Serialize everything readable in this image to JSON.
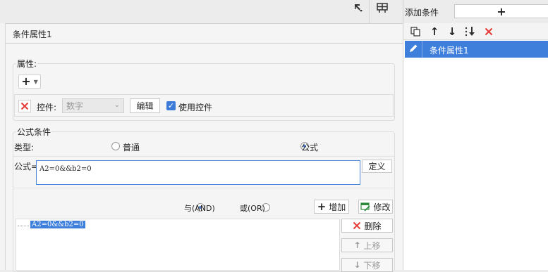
{
  "right_panel": {
    "add_condition_label": "添加条件",
    "add_button_glyph": "+",
    "toolbar_icons": [
      "copy-icon",
      "arrow-up-icon",
      "arrow-down-icon",
      "move-bottom-icon",
      "delete-icon"
    ],
    "items": [
      {
        "label": "条件属性1",
        "selected": true
      }
    ]
  },
  "dialog": {
    "title": "条件属性1",
    "property_group": {
      "label": "属性:",
      "add_glyph": "+",
      "widget_label": "控件:",
      "widget_select_value": "数字",
      "edit_button": "编辑",
      "use_widget_label": "使用控件",
      "use_widget_checked": true
    },
    "formula_group": {
      "label": "公式条件",
      "type_label": "类型:",
      "type_options": [
        "普通",
        "公式"
      ],
      "type_selected": "公式",
      "formula_label": "公式=",
      "formula_value": "A2=0&&b2=0",
      "define_button": "定义",
      "and_label": "与(AND)",
      "or_label": "或(OR)",
      "logic_selected": "与(AND)",
      "add_button": "增加",
      "modify_button": "修改",
      "condition_list": [
        "A2=0&&b2=0"
      ],
      "delete_button": "删除",
      "move_up_button": "上移",
      "move_down_button": "下移"
    }
  }
}
